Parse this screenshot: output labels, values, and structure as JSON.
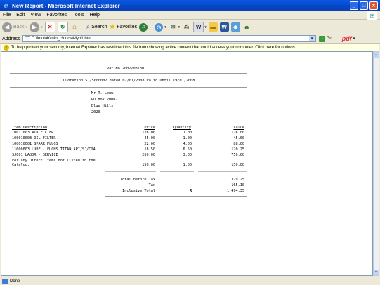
{
  "window": {
    "title": "New Report - Microsoft Internet Explorer"
  },
  "menu": [
    "File",
    "Edit",
    "View",
    "Favorites",
    "Tools",
    "Help"
  ],
  "toolbar": {
    "back_label": "Back",
    "search_label": "Search",
    "favorites_label": "Favorites"
  },
  "address": {
    "label": "Address",
    "value": "C:\\Infolab\\info_c\\docs\\Myh1.htm",
    "go_label": "Go",
    "pdf_label": "pdf"
  },
  "infobar": {
    "message": "To help protect your security, Internet Explorer has restricted this file from showing active content that could access your computer. Click here for options..."
  },
  "report": {
    "vat_no": "Vat No 2007/08/30",
    "quotation_line": "Quotation SJ/5000002 dated 02/01/2008 valid until 19/01/2008.",
    "address_lines": [
      "Mr R. Louw",
      "PO Box 20002",
      "Blue Hills",
      "2020"
    ],
    "headers": {
      "item": "Item Description",
      "price": "Price",
      "quantity": "Quantity",
      "value": "Value"
    },
    "items": [
      {
        "desc": "10011003 AIR FILTER",
        "price": "176.00",
        "qty": "1.00",
        "value": "176.00"
      },
      {
        "desc": "100010003 OIL FILTER",
        "price": "45.00",
        "qty": "1.00",
        "value": "45.00"
      },
      {
        "desc": "100010001 SPARK PLUGS",
        "price": "22.00",
        "qty": "4.00",
        "value": "88.00"
      },
      {
        "desc": "11000003 LUBE - FUCHS TITAN API/SJ/CD4",
        "price": "18.50",
        "qty": "6.50",
        "value": "120.25"
      },
      {
        "desc": "SJ001 LABOR - SERVICE",
        "price": "250.00",
        "qty": "3.00",
        "value": "750.00"
      },
      {
        "desc": "For any Direct Items not listed in the",
        "desc2": "Catalog.",
        "price": "150.00",
        "qty": "1.00",
        "value": "150.00"
      }
    ],
    "totals": {
      "before_tax_label": "Total before Tax",
      "before_tax_value": "1,329.25",
      "tax_label": "Tax",
      "tax_value": "165.10",
      "inclusive_label": "Inclusive Total",
      "currency": "R",
      "inclusive_value": "1,494.35"
    }
  },
  "status": {
    "text": "Done"
  }
}
